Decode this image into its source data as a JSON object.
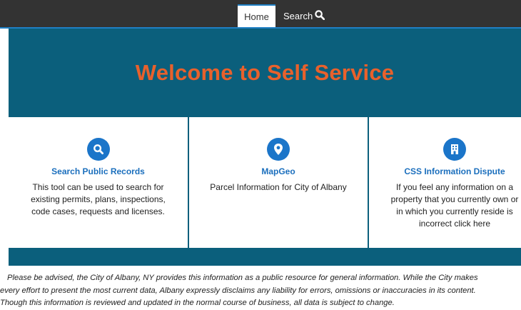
{
  "nav": {
    "home": "Home",
    "search": "Search",
    "search_icon": "search-icon"
  },
  "hero": {
    "title": "Welcome to Self Service",
    "title_color": "#e8612c",
    "background": "#0b5f7c"
  },
  "cards": [
    {
      "icon": "search-icon",
      "title": "Search Public Records",
      "description": "This tool can be used to search for existing permits, plans, inspections, code cases, requests and licenses."
    },
    {
      "icon": "map-marker-icon",
      "title": "MapGeo",
      "description": "Parcel Information for City of Albany"
    },
    {
      "icon": "building-icon",
      "title": "CSS Information Dispute",
      "description": "If you feel any information on a property that you currently own or in which you currently reside is incorrect click here"
    }
  ],
  "disclaimer": {
    "line1": "Please be advised, the City of Albany, NY provides this information as a public resource for general information. While the City makes",
    "line2": "every effort to present the most current data, Albany expressly disclaims any liability for errors, omissions or inaccuracies in its content.",
    "line3": "Though this information is reviewed and updated in the normal course of business, all data is subject to change."
  },
  "accent_color": "#1b75c9"
}
